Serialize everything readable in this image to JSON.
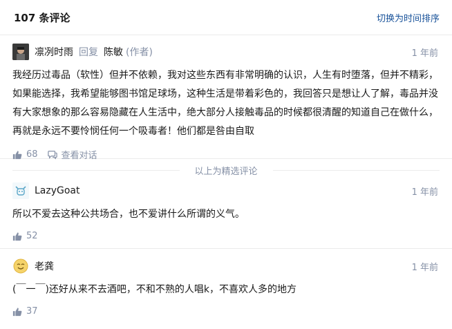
{
  "header": {
    "count_title": "107 条评论",
    "switch_label": "切换为时间排序"
  },
  "featured_divider": "以上为精选评论",
  "comments": [
    {
      "author": "凛冽时雨",
      "reply_word": "回复",
      "reply_to": "陈敏",
      "reply_to_role": "(作者)",
      "time": "1 年前",
      "content": "我经历过毒品（软性）但并不依赖，我对这些东西有非常明确的认识，人生有时堕落，但并不精彩，如果能选择，我希望能够图书馆足球场，这种生活是带着彩色的，我回答只是想让人了解，毒品并没有大家想象的那么容易隐藏在人生活中，绝大部分人接触毒品的时候都很清醒的知道自己在做什么，再就是永远不要怜悯任何一个吸毒者！他们都是咎由自取",
      "likes": "68",
      "view_reply_label": "查看对话"
    },
    {
      "author": "LazyGoat",
      "time": "1 年前",
      "content": "所以不爱去这种公共场合，也不爱讲什么所谓的义气。",
      "likes": "52"
    },
    {
      "author": "老龚",
      "time": "1 年前",
      "content": "(￣一￣)还好从来不去酒吧，不和不熟的人唱k，不喜欢人多的地方",
      "likes": "37"
    }
  ],
  "colors": {
    "link": "#175199",
    "muted": "#8590a6",
    "text": "#1a1a1a",
    "border": "#ebebeb"
  }
}
